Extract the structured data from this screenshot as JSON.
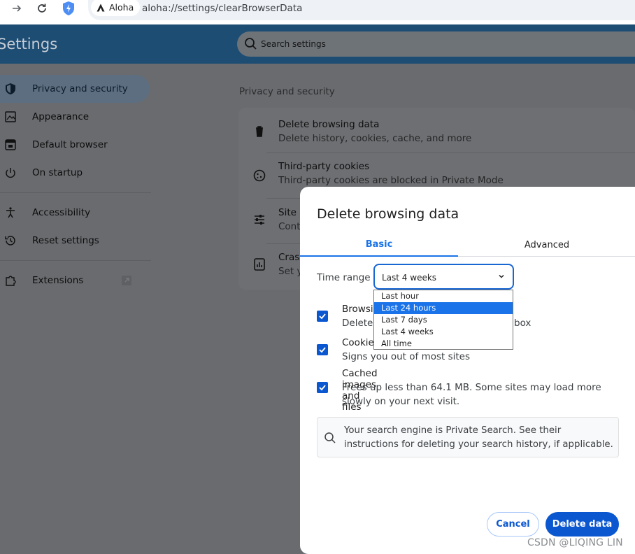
{
  "browser": {
    "site_chip": "Aloha",
    "url": "aloha://settings/clearBrowserData"
  },
  "settings": {
    "title": "Settings",
    "search_placeholder": "Search settings",
    "sidebar": {
      "items": [
        {
          "label": "Privacy and security",
          "icon": "shield-icon"
        },
        {
          "label": "Appearance",
          "icon": "image-icon"
        },
        {
          "label": "Default browser",
          "icon": "browser-icon"
        },
        {
          "label": "On startup",
          "icon": "power-icon"
        },
        {
          "label": "Accessibility",
          "icon": "accessibility-icon"
        },
        {
          "label": "Reset settings",
          "icon": "history-icon"
        },
        {
          "label": "Extensions",
          "icon": "puzzle-icon"
        }
      ]
    },
    "section_title": "Privacy and security",
    "rows": [
      {
        "title": "Delete browsing data",
        "subtitle": "Delete history, cookies, cache, and more"
      },
      {
        "title": "Third-party cookies",
        "subtitle": "Third-party cookies are blocked in Private Mode"
      },
      {
        "title": "Site s",
        "subtitle": "Cont"
      },
      {
        "title": "Crash",
        "subtitle": "Set y"
      }
    ]
  },
  "dialog": {
    "title": "Delete browsing data",
    "tabs": [
      "Basic",
      "Advanced"
    ],
    "time_range_label": "Time range",
    "time_range_value": "Last 4 weeks",
    "time_range_options": [
      "Last hour",
      "Last 24 hours",
      "Last 7 days",
      "Last 4 weeks",
      "All time"
    ],
    "highlighted_option": "Last 24 hours",
    "options": [
      {
        "title": "Browsin",
        "subtitle": "Deletes",
        "subtitle_tail": "box",
        "checked": true
      },
      {
        "title": "Cookies",
        "subtitle": "Signs you out of most sites",
        "checked": true
      },
      {
        "title": "Cached images and files",
        "subtitle": "Frees up less than 64.1 MB. Some sites may load more slowly on your next visit.",
        "checked": true
      }
    ],
    "info": "Your search engine is Private Search. See their instructions for deleting your search history, if applicable.",
    "cancel_label": "Cancel",
    "delete_label": "Delete data"
  },
  "watermark": "CSDN @LIQING LIN",
  "colors": {
    "accent": "#0b57d0",
    "tab_active": "#1a73e8",
    "header": "#1e4d74"
  }
}
